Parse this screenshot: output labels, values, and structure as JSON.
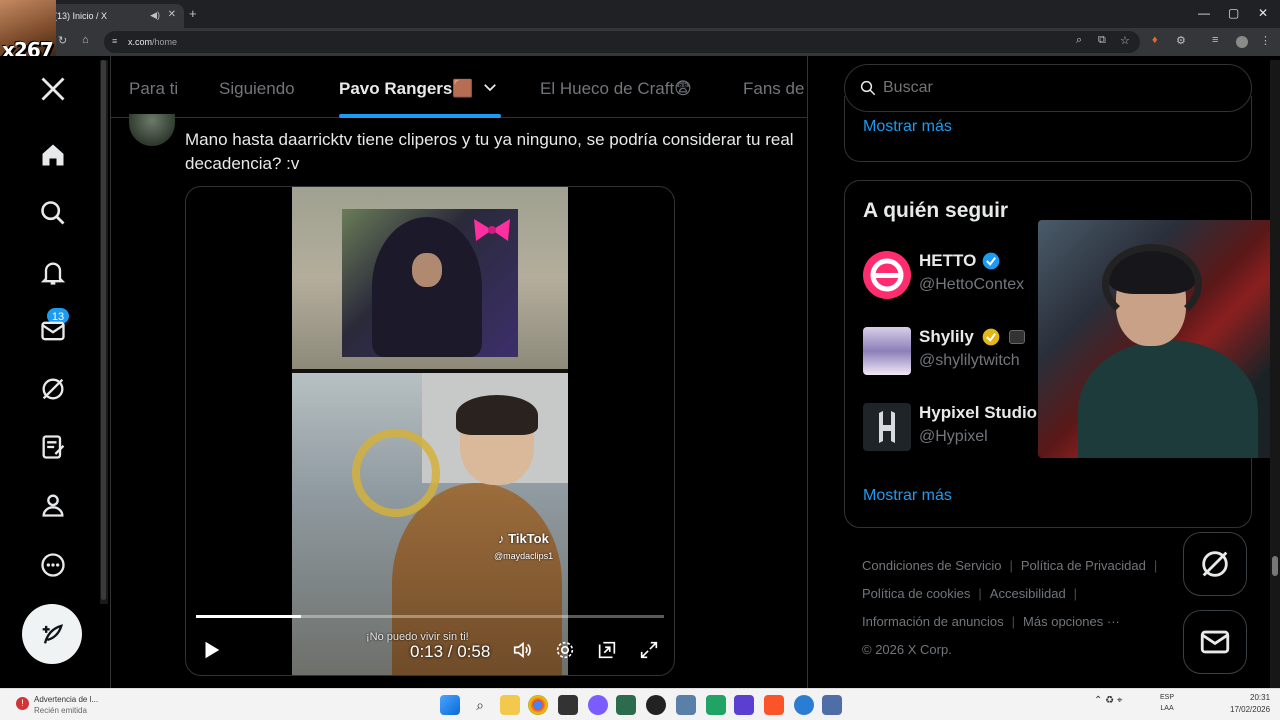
{
  "browser": {
    "tab_title": "(13) Inicio / X",
    "url_host": "x.com",
    "url_path": "/home",
    "new_tab": "+",
    "mute_icon": "speaker-icon",
    "close_tab": "✕",
    "minimize": "—",
    "maximize": "▢",
    "close_window": "✕"
  },
  "overlay": {
    "tag": "x267"
  },
  "nav": {
    "notifications_count": "13"
  },
  "feed": {
    "tabs": [
      {
        "label": "Para ti"
      },
      {
        "label": "Siguiendo"
      },
      {
        "label": "Pavo Rangers🟫",
        "active": true
      },
      {
        "label": "El Hueco de Craft😨"
      },
      {
        "label": "Fans de"
      }
    ],
    "tweet_text": "Mano hasta daarricktv tiene cliperos y tu ya ninguno, se podría considerar tu real decadencia? :v",
    "video": {
      "tiktok_label": "TikTok",
      "tiktok_handle": "@maydaclips1",
      "subtitle": "¡No puedo vivir sin ti!",
      "time": "0:13 / 0:58",
      "progress": 0.224
    }
  },
  "sidebar": {
    "search_placeholder": "Buscar",
    "show_more_1": "Mostrar más",
    "who_to_follow_title": "A quién seguir",
    "accounts": [
      {
        "name": "HETTO",
        "handle": "@HettoContex",
        "verified": "blue"
      },
      {
        "name": "Shylily",
        "handle": "@shylilytwitch",
        "verified": "gold"
      },
      {
        "name": "Hypixel Studio",
        "handle": "@Hypixel",
        "verified": "none"
      }
    ],
    "show_more_2": "Mostrar más",
    "footer": {
      "terms": "Condiciones de Servicio",
      "privacy": "Política de Privacidad",
      "cookies": "Política de cookies",
      "accessibility": "Accesibilidad",
      "ads_info": "Información de anuncios",
      "more": "Más opciones ···",
      "copyright": "© 2026 X Corp."
    }
  },
  "taskbar": {
    "notification_title": "Advertencia de l...",
    "notification_sub": "Recién emitida",
    "lang_line1": "ESP",
    "lang_line2": "LAA",
    "time": "20:31",
    "date": "17/02/2026"
  },
  "colors": {
    "accent": "#1d9bf0",
    "background": "#000000",
    "text_primary": "#e7e9ea",
    "text_secondary": "#71767b"
  }
}
